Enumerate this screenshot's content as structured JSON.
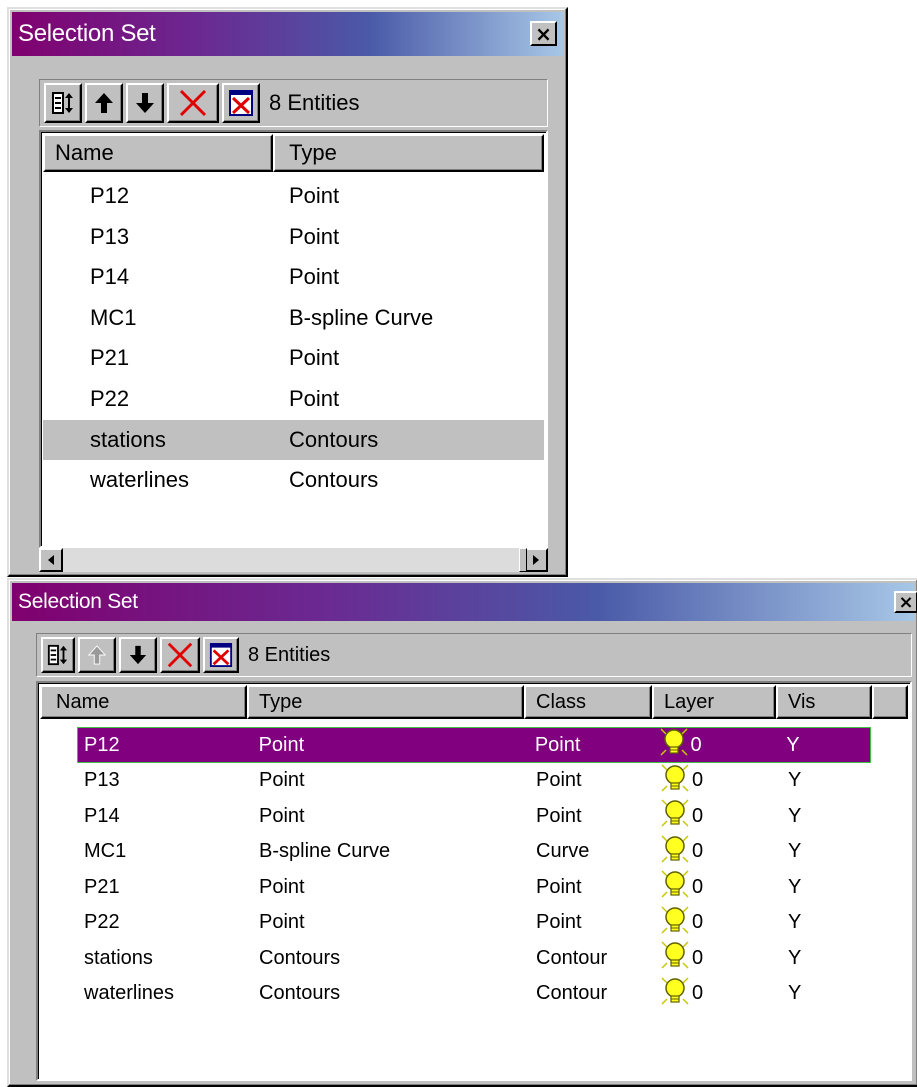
{
  "window1": {
    "title": "Selection Set",
    "close_glyph": "×",
    "toolbar": {
      "buttons": [
        {
          "name": "sort-order-icon"
        },
        {
          "name": "move-up-icon"
        },
        {
          "name": "move-down-icon"
        },
        {
          "name": "delete-red-x-icon"
        },
        {
          "name": "clear-all-icon"
        }
      ],
      "count_label": "8 Entities"
    },
    "columns": [
      "Name",
      "Type"
    ],
    "rows": [
      {
        "name": "P12",
        "type": "Point"
      },
      {
        "name": "P13",
        "type": "Point"
      },
      {
        "name": "P14",
        "type": "Point"
      },
      {
        "name": "MC1",
        "type": "B-spline Curve"
      },
      {
        "name": "P21",
        "type": "Point"
      },
      {
        "name": "P22",
        "type": "Point"
      },
      {
        "name": "stations",
        "type": "Contours"
      },
      {
        "name": "waterlines",
        "type": "Contours"
      }
    ],
    "selected_row_name": "stations",
    "selected_row_color": "#c0c0c0"
  },
  "window2": {
    "title": "Selection Set",
    "close_glyph": "×",
    "toolbar": {
      "buttons": [
        {
          "name": "sort-order-icon"
        },
        {
          "name": "move-up-icon",
          "disabled": true
        },
        {
          "name": "move-down-icon"
        },
        {
          "name": "delete-red-x-icon"
        },
        {
          "name": "clear-all-icon"
        }
      ],
      "count_label": "8 Entities"
    },
    "columns": [
      "Name",
      "Type",
      "Class",
      "Layer",
      "Vis"
    ],
    "rows": [
      {
        "name": "P12",
        "type": "Point",
        "class": "Point",
        "layer": "0",
        "vis": "Y"
      },
      {
        "name": "P13",
        "type": "Point",
        "class": "Point",
        "layer": "0",
        "vis": "Y"
      },
      {
        "name": "P14",
        "type": "Point",
        "class": "Point",
        "layer": "0",
        "vis": "Y"
      },
      {
        "name": "MC1",
        "type": "B-spline Curve",
        "class": "Curve",
        "layer": "0",
        "vis": "Y"
      },
      {
        "name": "P21",
        "type": "Point",
        "class": "Point",
        "layer": "0",
        "vis": "Y"
      },
      {
        "name": "P22",
        "type": "Point",
        "class": "Point",
        "layer": "0",
        "vis": "Y"
      },
      {
        "name": "stations",
        "type": "Contours",
        "class": "Contour",
        "layer": "0",
        "vis": "Y"
      },
      {
        "name": "waterlines",
        "type": "Contours",
        "class": "Contour",
        "layer": "0",
        "vis": "Y"
      }
    ],
    "selected_row_name": "P12",
    "selected_row_color": "#800080",
    "layer_icon": "lightbulb-icon"
  }
}
